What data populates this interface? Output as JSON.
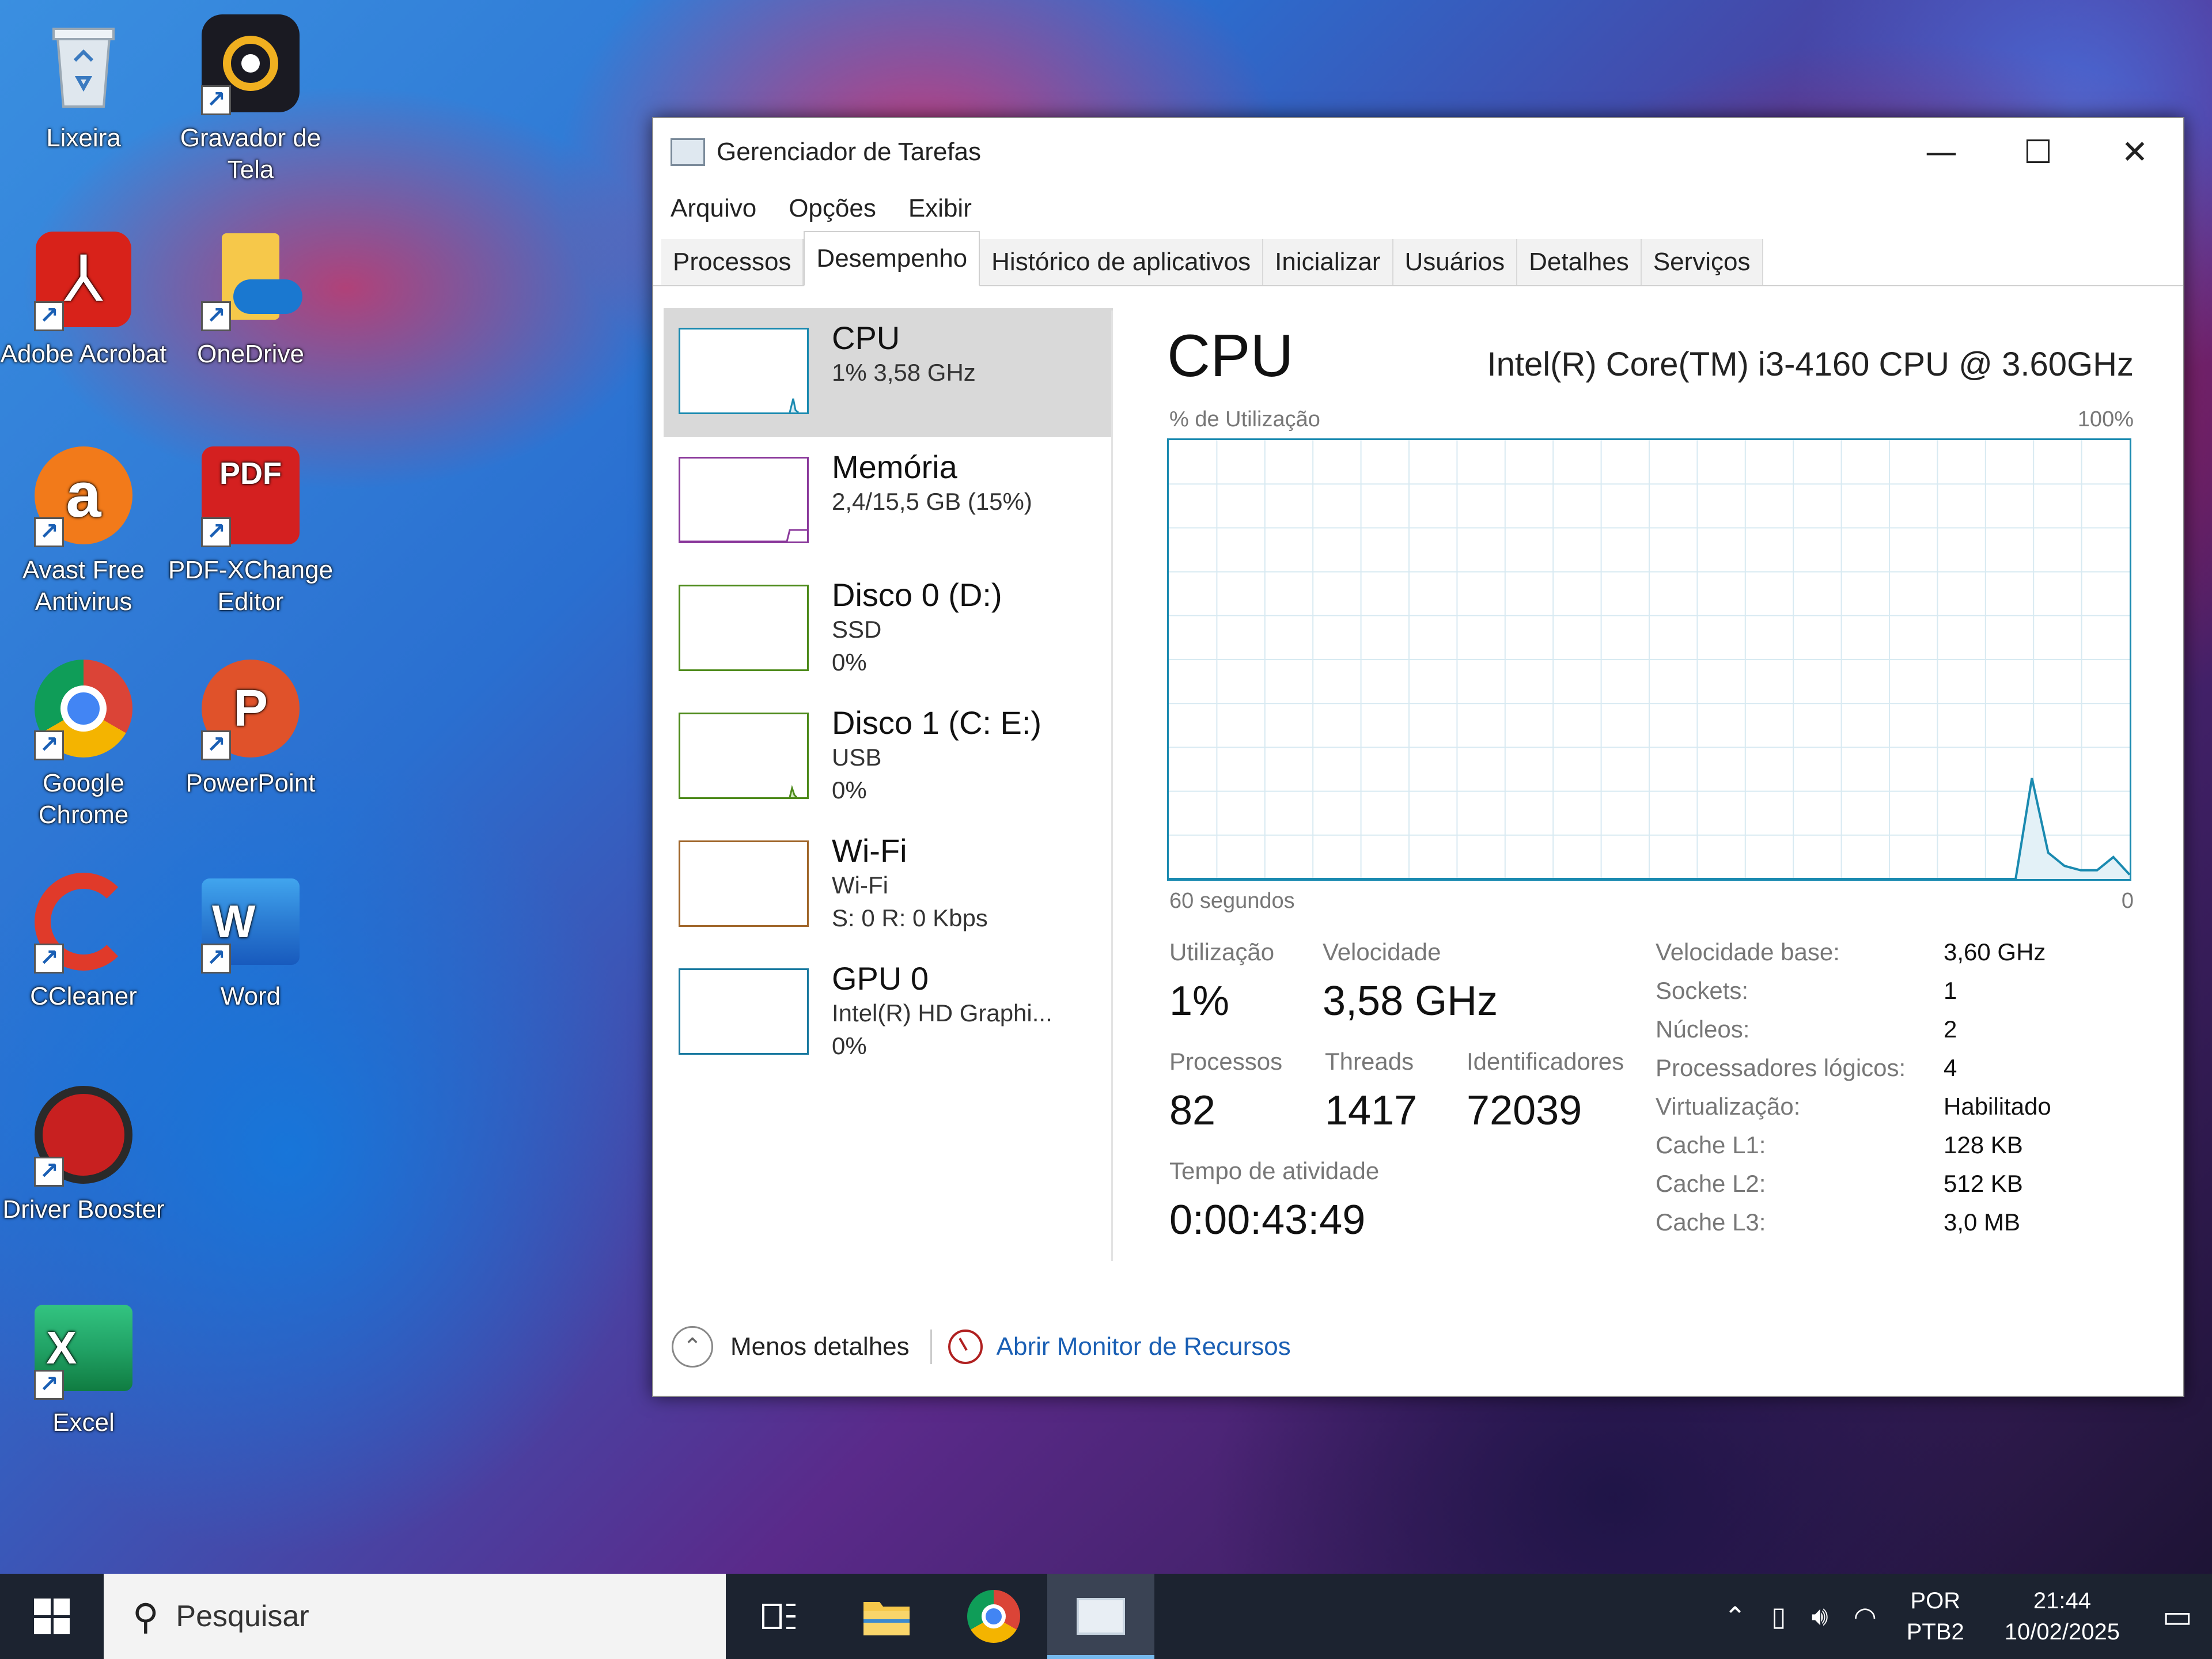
{
  "desktop": {
    "icons": [
      {
        "label": "Lixeira"
      },
      {
        "label": "Gravador de Tela"
      },
      {
        "label": "Adobe Acrobat"
      },
      {
        "label": "OneDrive"
      },
      {
        "label": "Avast Free Antivirus"
      },
      {
        "label": "PDF-XChange Editor"
      },
      {
        "label": "Google Chrome"
      },
      {
        "label": "PowerPoint"
      },
      {
        "label": "CCleaner"
      },
      {
        "label": "Word"
      },
      {
        "label": "Driver Booster"
      },
      {
        "label": "Excel"
      }
    ]
  },
  "window": {
    "title": "Gerenciador de Tarefas",
    "minimize": "—",
    "maximize": "☐",
    "close": "✕",
    "menu": [
      "Arquivo",
      "Opções",
      "Exibir"
    ],
    "tabs": [
      "Processos",
      "Desempenho",
      "Histórico de aplicativos",
      "Inicializar",
      "Usuários",
      "Detalhes",
      "Serviços"
    ],
    "active_tab": "Desempenho"
  },
  "sidebar": {
    "items": [
      {
        "title": "CPU",
        "line1": "1%  3,58 GHz",
        "line2": "",
        "color": "#1a8ab0"
      },
      {
        "title": "Memória",
        "line1": "2,4/15,5 GB (15%)",
        "line2": "",
        "color": "#8b3a9c"
      },
      {
        "title": "Disco 0 (D:)",
        "line1": "SSD",
        "line2": "0%",
        "color": "#4d8a1a"
      },
      {
        "title": "Disco 1 (C: E:)",
        "line1": "USB",
        "line2": "0%",
        "color": "#4d8a1a"
      },
      {
        "title": "Wi-Fi",
        "line1": "Wi-Fi",
        "line2": "S: 0  R: 0 Kbps",
        "color": "#a0662a"
      },
      {
        "title": "GPU 0",
        "line1": "Intel(R) HD Graphi...",
        "line2": "0%",
        "color": "#1a7aa0"
      }
    ]
  },
  "main": {
    "title": "CPU",
    "model": "Intel(R) Core(TM) i3-4160 CPU @ 3.60GHz",
    "util_label": "% de Utilização",
    "util_max": "100%",
    "axis_left": "60 segundos",
    "axis_right": "0",
    "stats": {
      "utilizacao_label": "Utilização",
      "utilizacao": "1%",
      "velocidade_label": "Velocidade",
      "velocidade": "3,58 GHz",
      "processos_label": "Processos",
      "processos": "82",
      "threads_label": "Threads",
      "threads": "1417",
      "identificadores_label": "Identificadores",
      "identificadores": "72039",
      "tempo_label": "Tempo de atividade",
      "tempo": "0:00:43:49"
    },
    "specs": [
      {
        "k": "Velocidade base:",
        "v": "3,60 GHz"
      },
      {
        "k": "Sockets:",
        "v": "1"
      },
      {
        "k": "Núcleos:",
        "v": "2"
      },
      {
        "k": "Processadores lógicos:",
        "v": "4"
      },
      {
        "k": "Virtualização:",
        "v": "Habilitado"
      },
      {
        "k": "Cache L1:",
        "v": "128 KB"
      },
      {
        "k": "Cache L2:",
        "v": "512 KB"
      },
      {
        "k": "Cache L3:",
        "v": "3,0 MB"
      }
    ],
    "graph_color": "#1a8ab0",
    "graph_series": [
      0,
      0,
      0,
      0,
      0,
      0,
      0,
      0,
      0,
      0,
      0,
      0,
      0,
      0,
      0,
      0,
      0,
      0,
      0,
      0,
      0,
      0,
      0,
      0,
      0,
      0,
      0,
      0,
      0,
      0,
      0,
      0,
      0,
      0,
      0,
      0,
      0,
      0,
      0,
      0,
      0,
      0,
      0,
      0,
      0,
      0,
      0,
      0,
      0,
      0,
      0,
      0,
      0,
      23,
      6,
      3,
      2,
      2,
      5,
      1
    ]
  },
  "footer": {
    "less_details": "Menos detalhes",
    "resource_monitor": "Abrir Monitor de Recursos"
  },
  "taskbar": {
    "search_placeholder": "Pesquisar",
    "lang_line1": "POR",
    "lang_line2": "PTB2",
    "time": "21:44",
    "date": "10/02/2025"
  }
}
